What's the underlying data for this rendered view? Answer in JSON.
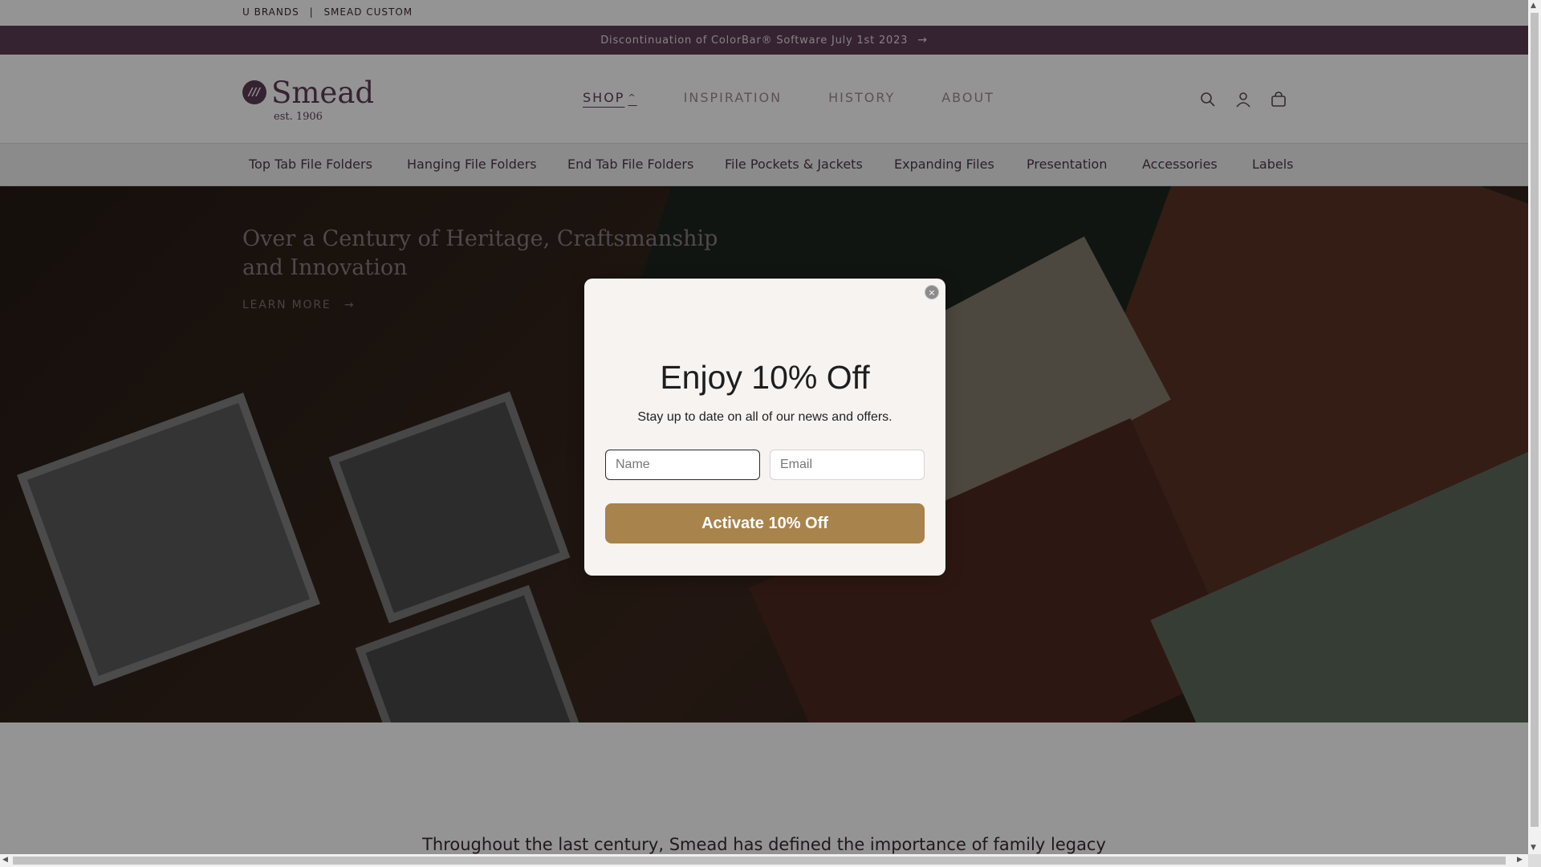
{
  "utility": {
    "links": [
      "U BRANDS",
      "|",
      "SMEAD CUSTOM"
    ]
  },
  "announcement": {
    "text": "Discontinuation of ColorBar® Software July 1st 2023",
    "arrow": "→"
  },
  "logo": {
    "mark": "///",
    "name": "Smead",
    "est": "est. 1906"
  },
  "main_nav": {
    "items": [
      "SHOP",
      "INSPIRATION",
      "HISTORY",
      "ABOUT"
    ],
    "active": "SHOP"
  },
  "header_icons": [
    "search-icon",
    "account-icon",
    "cart-icon"
  ],
  "categories": [
    "Top Tab File Folders",
    "Hanging File Folders",
    "End Tab File Folders",
    "File Pockets & Jackets",
    "Expanding Files",
    "Presentation",
    "Accessories",
    "Labels"
  ],
  "hero": {
    "title": "Over a Century of Heritage, Craftsmanship and Innovation",
    "link": "LEARN MORE",
    "link_arrow": "→"
  },
  "below": {
    "text": "Throughout the last century, Smead has defined the importance of family legacy"
  },
  "popup": {
    "close": "×",
    "title": "Enjoy 10% Off",
    "subtitle": "Stay up to date on all of our news and offers.",
    "name_placeholder": "Name",
    "email_placeholder": "Email",
    "button": "Activate 10% Off"
  },
  "colors": {
    "brand": "#5e3d55",
    "button": "#a8834c"
  }
}
